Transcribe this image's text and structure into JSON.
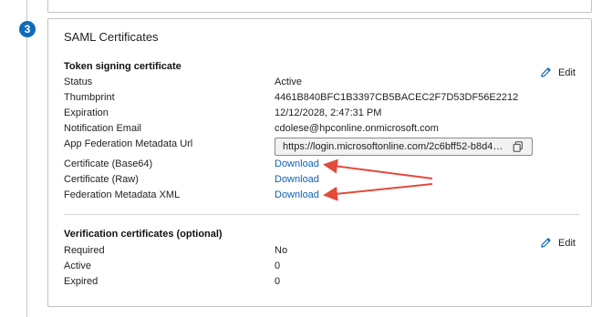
{
  "step_number": "3",
  "card_title": "SAML Certificates",
  "token_signing": {
    "heading": "Token signing certificate",
    "edit_label": "Edit",
    "rows": [
      {
        "label": "Status",
        "value": "Active"
      },
      {
        "label": "Thumbprint",
        "value": "4461B840BFC1B3397CB5BACEC2F7D53DF56E2212"
      },
      {
        "label": "Expiration",
        "value": "12/12/2028, 2:47:31 PM"
      },
      {
        "label": "Notification Email",
        "value": "cdolese@hpconline.onmicrosoft.com"
      }
    ],
    "metadata_url_label": "App Federation Metadata Url",
    "metadata_url_value": "https://login.microsoftonline.com/2c6bff52-b8d4-...",
    "downloads": [
      {
        "label": "Certificate (Base64)",
        "link": "Download"
      },
      {
        "label": "Certificate (Raw)",
        "link": "Download"
      },
      {
        "label": "Federation Metadata XML",
        "link": "Download"
      }
    ]
  },
  "verification": {
    "heading": "Verification certificates (optional)",
    "edit_label": "Edit",
    "rows": [
      {
        "label": "Required",
        "value": "No"
      },
      {
        "label": "Active",
        "value": "0"
      },
      {
        "label": "Expired",
        "value": "0"
      }
    ]
  },
  "colors": {
    "accent": "#0f6cbd",
    "link": "#0f62b3",
    "annotation_arrow": "#e24a3b"
  },
  "icons": {
    "edit": "pencil-icon",
    "copy": "copy-icon"
  }
}
